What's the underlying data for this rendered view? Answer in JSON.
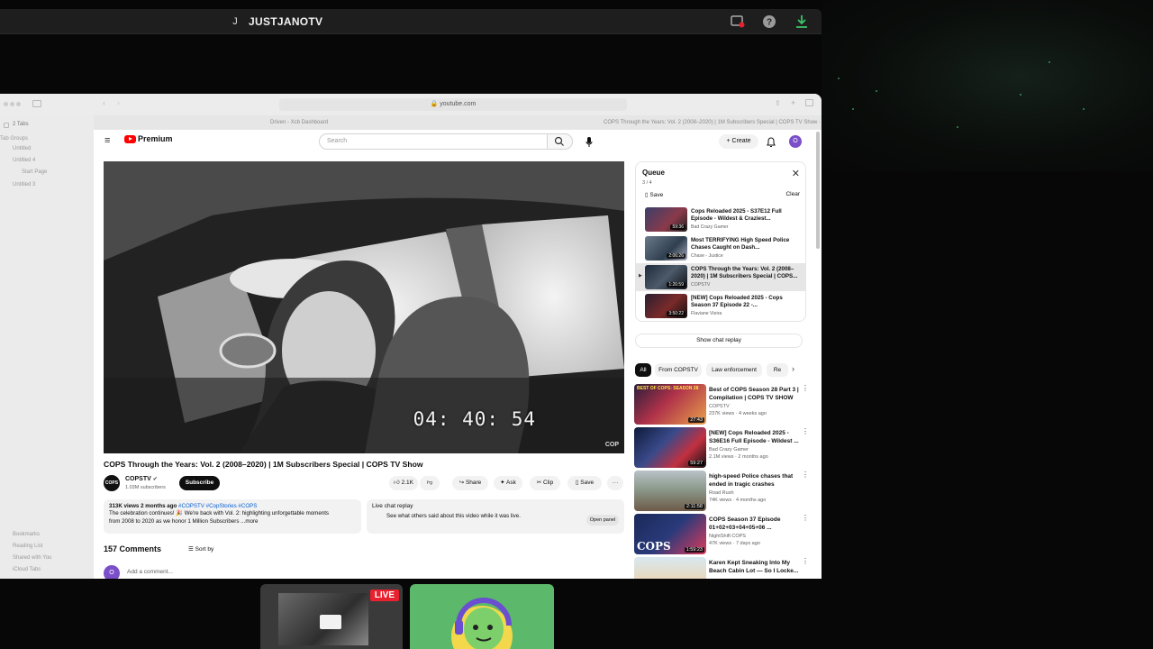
{
  "stream": {
    "avatar_initial": "J",
    "streamer_name": "JUSTJANOTV",
    "live_label": "LIVE"
  },
  "browser": {
    "url": "youtube.com",
    "tabs": [
      "Driven - Xcb Dashboard",
      "COPS Through the Years: Vol. 2 (2008–2020) | 1M Subscribers Special | COPS TV Show - YouTube"
    ],
    "sidebar_top": [
      "2 Tabs",
      "Tab Groups",
      "Untitled",
      "Untitled 4",
      "Start Page",
      "Untitled 3"
    ],
    "sidebar_bottom": [
      "Bookmarks",
      "Reading List",
      "Shared with You",
      "iCloud Tabs"
    ]
  },
  "youtube": {
    "logo": "Premium",
    "search_placeholder": "Search",
    "create": "Create",
    "user_initial": "O",
    "video": {
      "timecode": "04: 40: 54",
      "watermark": "COP",
      "title": "COPS Through the Years: Vol. 2 (2008–2020) | 1M Subscribers Special | COPS TV Show",
      "channel": "COPSTV",
      "channel_logo": "COPS",
      "subscribers": "1.03M subscribers",
      "subscribe": "Subscribe",
      "likes": "2.1K",
      "share": "Share",
      "ask": "Ask",
      "clip": "Clip",
      "save": "Save",
      "more": "···"
    },
    "description": {
      "meta": "313K views  2 months ago",
      "tags": "#COPSTV #CopStories #COPS",
      "line1": "The celebration continues! 🎉 We're back with Vol. 2: highlighting unforgettable moments",
      "line2": "from 2008 to 2020 as we honor 1 Million Subscribers ...more"
    },
    "live_chat": {
      "title": "Live chat replay",
      "text": "See what others said about this video while it was live.",
      "button": "Open panel"
    },
    "comments": {
      "count": "157 Comments",
      "sort": "Sort by",
      "placeholder": "Add a comment..."
    },
    "queue": {
      "title": "Queue",
      "count": "3 / 4",
      "save": "Save",
      "clear": "Clear",
      "items": [
        {
          "title": "Cops Reloaded 2025 - S37E12 Full Episode - Wildest & Craziest...",
          "channel": "Bad Crazy Gamer",
          "duration": "59:36"
        },
        {
          "title": "Most TERRIFYING High Speed Police Chases Caught on Dash...",
          "channel": "Chase - Justice",
          "duration": "2:06:26"
        },
        {
          "title": "COPS Through the Years: Vol. 2 (2008–2020) | 1M Subscribers Special | COPS...",
          "channel": "COPSTV",
          "duration": "1:26:59"
        },
        {
          "title": "[NEW] Cops Reloaded 2025 - Cops Season 37 Episode 22 -...",
          "channel": "Flaviane Vieira",
          "duration": "3:50:22"
        }
      ]
    },
    "show_chat_replay": "Show chat replay",
    "chips": [
      "All",
      "From COPSTV",
      "Law enforcement",
      "Re"
    ],
    "recommendations": [
      {
        "title": "Best of COPS Season 28 Part 3 | Compilation | COPS TV SHOW",
        "channel": "COPSTV",
        "meta": "237K views · 4 weeks ago",
        "duration": "27:43",
        "thumb_text": "BEST OF COPS: SEASON 28"
      },
      {
        "title": "[NEW] Cops Reloaded 2025 - S36E16 Full Episode - Wildest ...",
        "channel": "Bad Crazy Gamer",
        "meta": "2.1M views · 2 months ago",
        "duration": "59:27",
        "thumb_text": ""
      },
      {
        "title": "high-speed Police chases that ended in tragic crashes",
        "channel": "Road Rush",
        "meta": "74K views · 4 months ago",
        "duration": "2:11:58",
        "thumb_text": ""
      },
      {
        "title": "COPS Season 37 Episode 01+02+03+04+05+06 ...",
        "channel": "NightShift COPS",
        "meta": "47K views · 7 days ago",
        "duration": "1:59:23",
        "thumb_text": "COPS"
      },
      {
        "title": "Karen Kept Sneaking Into My Beach Cabin Lot — So I Locke...",
        "channel": "",
        "meta": "",
        "duration": "",
        "thumb_text": ""
      }
    ]
  },
  "colors": {
    "accent": "#ff0000",
    "live": "#e9202e",
    "tile_green": "#5cb86a",
    "avatar_purple": "#7b4fc9"
  }
}
